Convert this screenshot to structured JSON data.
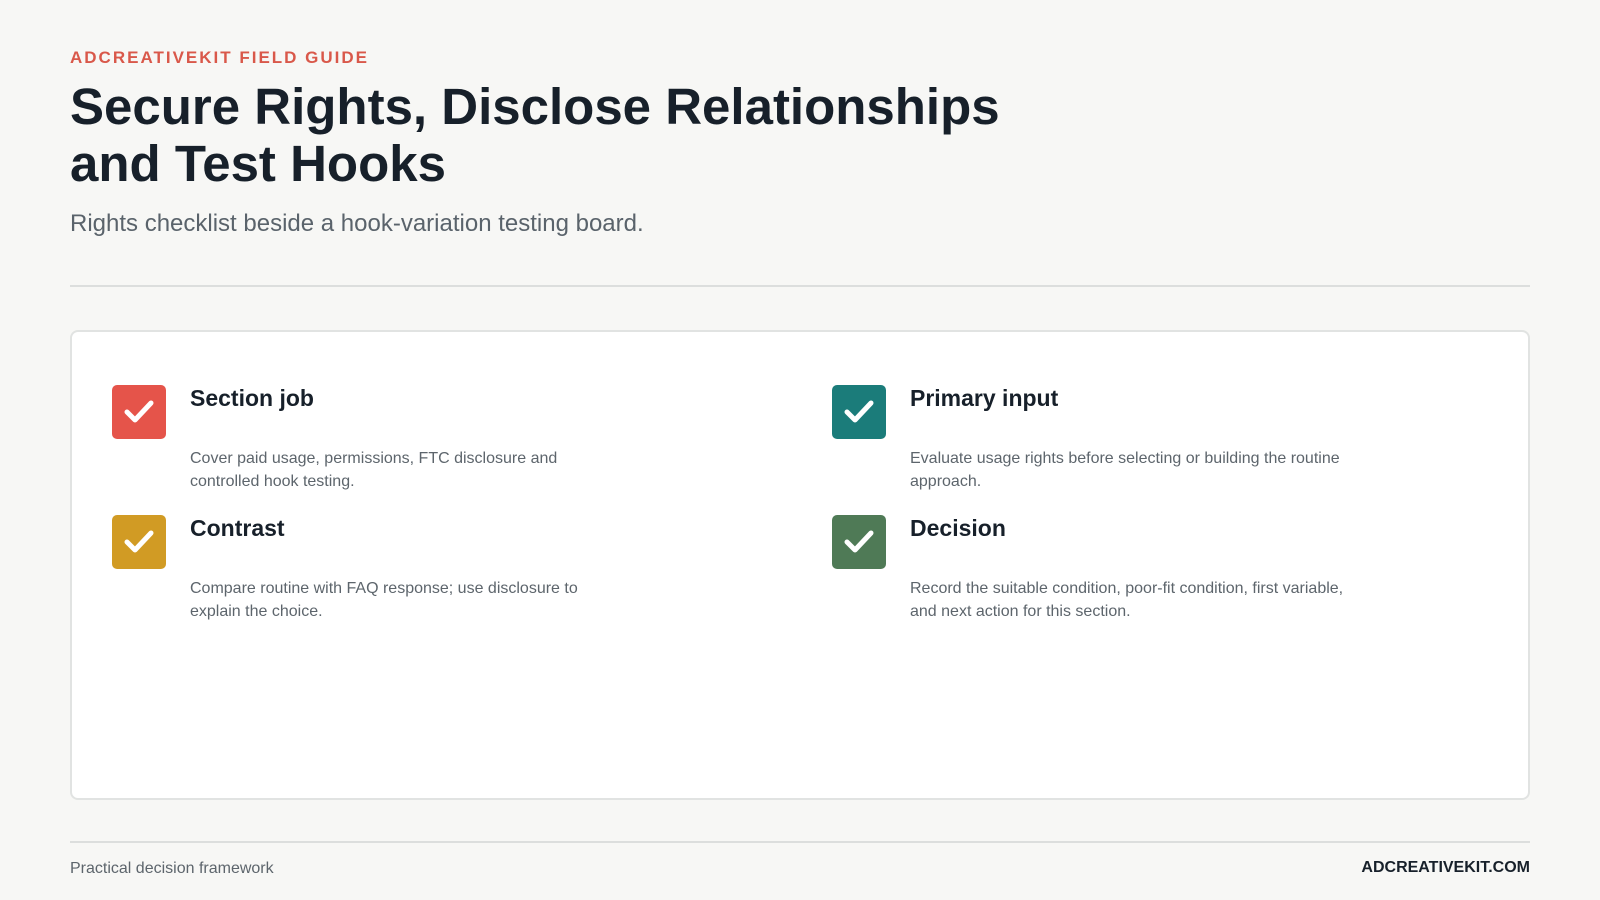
{
  "header": {
    "eyebrow": "ADCREATIVEKIT FIELD GUIDE",
    "title": "Secure Rights, Disclose Relationships and Test Hooks",
    "subtitle": "Rights checklist beside a hook-variation testing board."
  },
  "checklist": [
    {
      "title": "Section job",
      "body": "Cover paid usage, permissions, FTC disclosure and controlled hook testing.",
      "color": "#e5544a",
      "icon": "checkmark-icon"
    },
    {
      "title": "Primary input",
      "body": "Evaluate usage rights before selecting or building the routine approach.",
      "color": "#1b7c7a",
      "icon": "checkmark-icon"
    },
    {
      "title": "Contrast",
      "body": "Compare routine with FAQ response; use disclosure to explain the choice.",
      "color": "#d19b24",
      "icon": "checkmark-icon"
    },
    {
      "title": "Decision",
      "body": "Record the suitable condition, poor-fit condition, first variable, and next action for this section.",
      "color": "#4f7a56",
      "icon": "checkmark-icon"
    }
  ],
  "footer": {
    "left": "Practical decision framework",
    "right": "ADCREATIVEKIT.COM"
  }
}
